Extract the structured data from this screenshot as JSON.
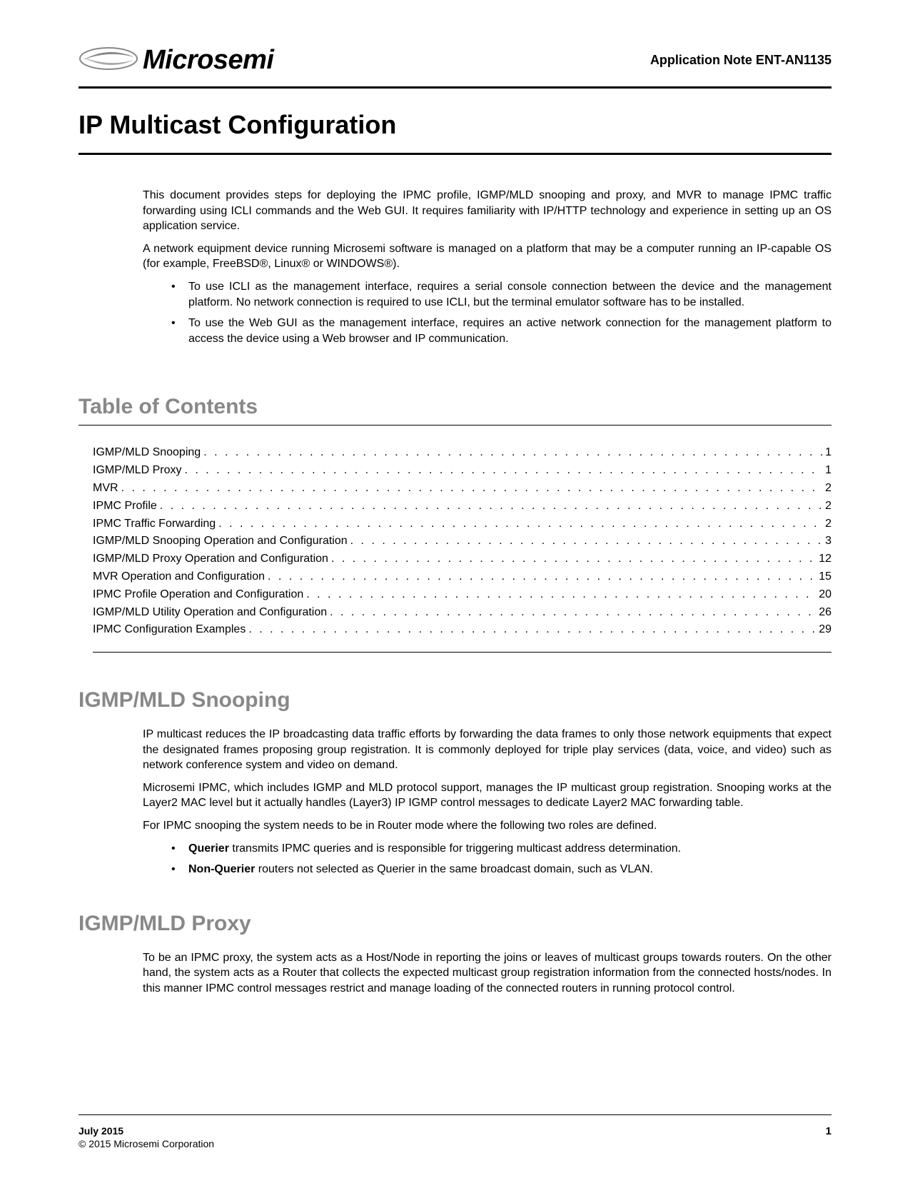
{
  "header": {
    "brand": "Microsemi",
    "app_note": "Application Note ENT-AN1135"
  },
  "title": "IP Multicast Configuration",
  "intro": {
    "p1": "This document provides steps for deploying the IPMC profile, IGMP/MLD snooping and proxy, and MVR to manage IPMC traffic forwarding using ICLI commands and the Web GUI. It requires familiarity with IP/HTTP technology and experience in setting up an OS application service.",
    "p2": "A network equipment device running Microsemi software is managed on a platform that may be a computer running an IP-capable OS (for example, FreeBSD®, Linux® or WINDOWS®).",
    "b1": "To use ICLI as the management interface, requires a serial console connection between the device and the management platform. No network connection is required to use ICLI, but the terminal emulator software has to be installed.",
    "b2": "To use the Web GUI as the management interface, requires an active network connection for the management platform to access the device using a Web browser and IP communication."
  },
  "toc": {
    "heading": "Table of Contents",
    "items": [
      {
        "title": "IGMP/MLD Snooping",
        "page": "1"
      },
      {
        "title": "IGMP/MLD Proxy",
        "page": "1"
      },
      {
        "title": "MVR",
        "page": "2"
      },
      {
        "title": "IPMC Profile",
        "page": "2"
      },
      {
        "title": "IPMC Traffic Forwarding",
        "page": "2"
      },
      {
        "title": "IGMP/MLD Snooping Operation and Configuration",
        "page": "3"
      },
      {
        "title": "IGMP/MLD Proxy Operation and Configuration",
        "page": "12"
      },
      {
        "title": "MVR Operation and Configuration",
        "page": "15"
      },
      {
        "title": "IPMC Profile Operation and Configuration",
        "page": "20"
      },
      {
        "title": "IGMP/MLD Utility Operation and Configuration",
        "page": "26"
      },
      {
        "title": "IPMC Configuration Examples",
        "page": "29"
      }
    ]
  },
  "snooping": {
    "heading": "IGMP/MLD Snooping",
    "p1": "IP multicast reduces the IP broadcasting data traffic efforts by forwarding the data frames to only those network equipments that expect the designated frames proposing group registration. It is commonly deployed for triple play services (data, voice, and video) such as network conference system and video on demand.",
    "p2": "Microsemi IPMC, which includes IGMP and MLD protocol support, manages the IP multicast group registration. Snooping works at the Layer2 MAC level but it actually handles (Layer3) IP IGMP control messages to dedicate Layer2 MAC forwarding table.",
    "p3": "For IPMC snooping the system needs to be in Router mode where the following two roles are defined.",
    "b1_bold": "Querier",
    "b1_rest": " transmits IPMC queries and is responsible for triggering multicast address determination.",
    "b2_bold": "Non-Querier",
    "b2_rest": " routers not selected as Querier in the same broadcast domain, such as VLAN."
  },
  "proxy": {
    "heading": "IGMP/MLD Proxy",
    "p1": "To be an IPMC proxy, the system acts as a Host/Node in reporting the joins or leaves of multicast groups towards routers. On the other hand, the system acts as a Router that collects the expected multicast group registration information from the connected hosts/nodes. In this manner IPMC control messages restrict and manage loading of the connected routers in running protocol control."
  },
  "footer": {
    "date": "July 2015",
    "copyright": "© 2015 Microsemi Corporation",
    "page": "1"
  }
}
